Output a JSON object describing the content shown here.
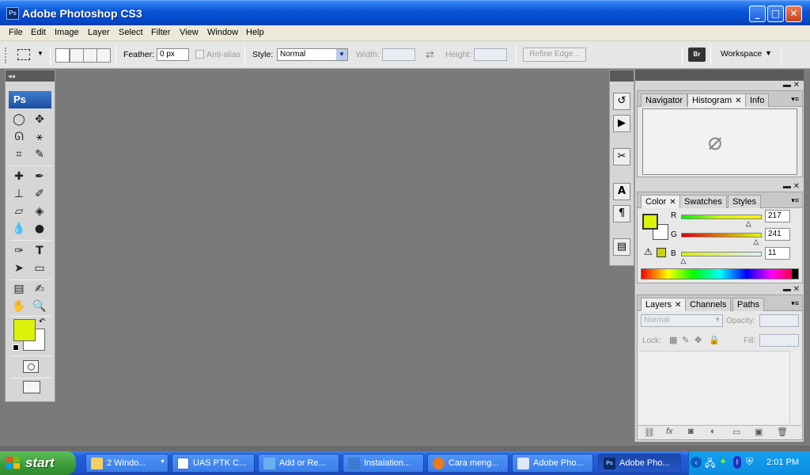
{
  "window": {
    "title": "Adobe Photoshop CS3",
    "app_badge": "Ps"
  },
  "menu": [
    "File",
    "Edit",
    "Image",
    "Layer",
    "Select",
    "Filter",
    "View",
    "Window",
    "Help"
  ],
  "options": {
    "feather_label": "Feather:",
    "feather_value": "0 px",
    "antialias_label": "Anti-alias",
    "style_label": "Style:",
    "style_value": "Normal",
    "width_label": "Width:",
    "height_label": "Height:",
    "refine_edge": "Refine Edge...",
    "workspace": "Workspace"
  },
  "toolbox": {
    "logo": "Ps",
    "foreground_color": "#dcf20b",
    "background_color": "#ffffff"
  },
  "panels": {
    "group1_tabs": [
      "Navigator",
      "Histogram",
      "Info"
    ],
    "group2_tabs": [
      "Color",
      "Swatches",
      "Styles"
    ],
    "group3_tabs": [
      "Layers",
      "Channels",
      "Paths"
    ],
    "color": {
      "r_label": "R",
      "g_label": "G",
      "b_label": "B",
      "r": "217",
      "g": "241",
      "b": "11",
      "r_fraction": 0.851,
      "g_fraction": 0.945,
      "b_fraction": 0.043
    },
    "layers": {
      "blend_mode": "Normal",
      "opacity_label": "Opacity:",
      "lock_label": "Lock:",
      "fill_label": "Fill:"
    }
  },
  "taskbar": {
    "start": "start",
    "buttons": [
      "2 Windo...",
      "UAS PTK C...",
      "Add or Re...",
      "Instalation...",
      "Cara meng...",
      "Adobe Pho...",
      "Adobe Pho..."
    ],
    "clock": "2:01 PM"
  }
}
